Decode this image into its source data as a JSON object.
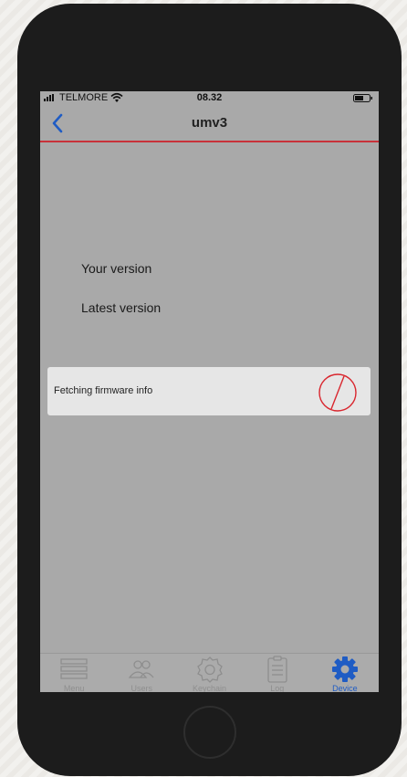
{
  "status_bar": {
    "carrier": "TELMORE",
    "time": "08.32",
    "icons": [
      "signal-icon",
      "wifi-icon",
      "battery-icon"
    ]
  },
  "nav": {
    "title": "umv3",
    "back_icon": "chevron-left-icon"
  },
  "main": {
    "your_version_label": "Your version",
    "latest_version_label": "Latest version"
  },
  "progress": {
    "message": "Fetching firmware info",
    "icon": "spinner-icon"
  },
  "tabs": [
    {
      "label": "Menu",
      "icon": "menu-icon",
      "active": false
    },
    {
      "label": "Users",
      "icon": "users-icon",
      "active": false
    },
    {
      "label": "Keychain",
      "icon": "keychain-icon",
      "active": false
    },
    {
      "label": "Log",
      "icon": "log-icon",
      "active": false
    },
    {
      "label": "Device",
      "icon": "gear-icon",
      "active": true
    }
  ],
  "colors": {
    "accent": "#1f5cc4",
    "nav_underline": "#c8323a",
    "spinner": "#d9262e",
    "screen_background": "#a9a9a9"
  }
}
